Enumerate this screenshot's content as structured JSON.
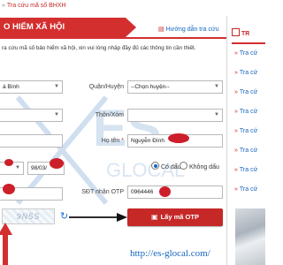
{
  "breadcrumb": {
    "separator": "»",
    "current": "Tra cứu mã số BHXH"
  },
  "form": {
    "title": "TRA CỨU MÃ SỐ BẢO HIỂM XÃ HỘI",
    "title_visible": "O HIỂM XÃ HỘI",
    "help_link": "Hướng dẫn tra cứu",
    "instruction": "ra cứu mã số bảo hiểm xã hội, xin vui lòng nhập đầy đủ các thông tin cần thiết.",
    "province_value": "à Bình",
    "district_label": "Quận/Huyện",
    "district_placeholder": "--Chọn huyện--",
    "village_label": "Thôn/Xóm",
    "name_label": "Họ tên",
    "name_value": "Nguyễn Đình",
    "required_mark": "*",
    "dob_value": "98/03/",
    "accent_yes": "Có dấu",
    "accent_no": "Không dấu",
    "phone_label": "SĐT nhận OTP",
    "phone_value": "0964446",
    "captcha_text": "9N5S",
    "otp_button": "Lấy mã OTP"
  },
  "watermark": {
    "text": "ES",
    "subtext": "GLOCAL"
  },
  "site_url": "http://es-glocal.com/",
  "sidebar": {
    "heading": "TR",
    "items": [
      "Tra cứ",
      "Tra cứ",
      "Tra cứ",
      "Tra cứ",
      "Tra cứ",
      "Tra cứ",
      "Tra cứ",
      "Tra cứ"
    ]
  },
  "colors": {
    "accent": "#d32f2f",
    "link": "#1565c0"
  }
}
